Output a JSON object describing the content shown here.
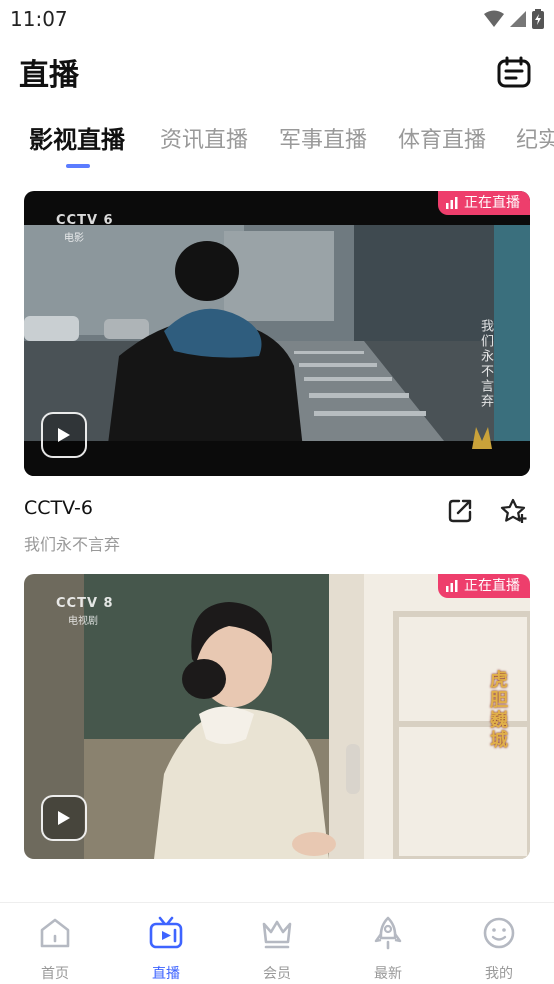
{
  "status_bar": {
    "time": "11:07"
  },
  "header": {
    "title": "直播"
  },
  "tabs": [
    {
      "label": "影视直播",
      "active": true
    },
    {
      "label": "资讯直播",
      "active": false
    },
    {
      "label": "军事直播",
      "active": false
    },
    {
      "label": "体育直播",
      "active": false
    },
    {
      "label": "纪实",
      "active": false
    }
  ],
  "cards": [
    {
      "badge": "正在直播",
      "channel_logo": "CCTV 6",
      "channel_sub": "电影",
      "overlay_text": "我们永不言弃",
      "title": "CCTV-6",
      "subtitle": "我们永不言弃"
    },
    {
      "badge": "正在直播",
      "channel_logo": "CCTV 8",
      "channel_sub": "电视剧",
      "overlay_text": "虎胆巍城"
    }
  ],
  "bottom_nav": [
    {
      "label": "首页",
      "icon": "home-icon",
      "active": false
    },
    {
      "label": "直播",
      "icon": "tv-icon",
      "active": true
    },
    {
      "label": "会员",
      "icon": "crown-icon",
      "active": false
    },
    {
      "label": "最新",
      "icon": "rocket-icon",
      "active": false
    },
    {
      "label": "我的",
      "icon": "smile-icon",
      "active": false
    }
  ],
  "colors": {
    "accent": "#3e64ff",
    "tab_indicator": "#5b7cff",
    "live_badge": "#ee3e6c"
  }
}
